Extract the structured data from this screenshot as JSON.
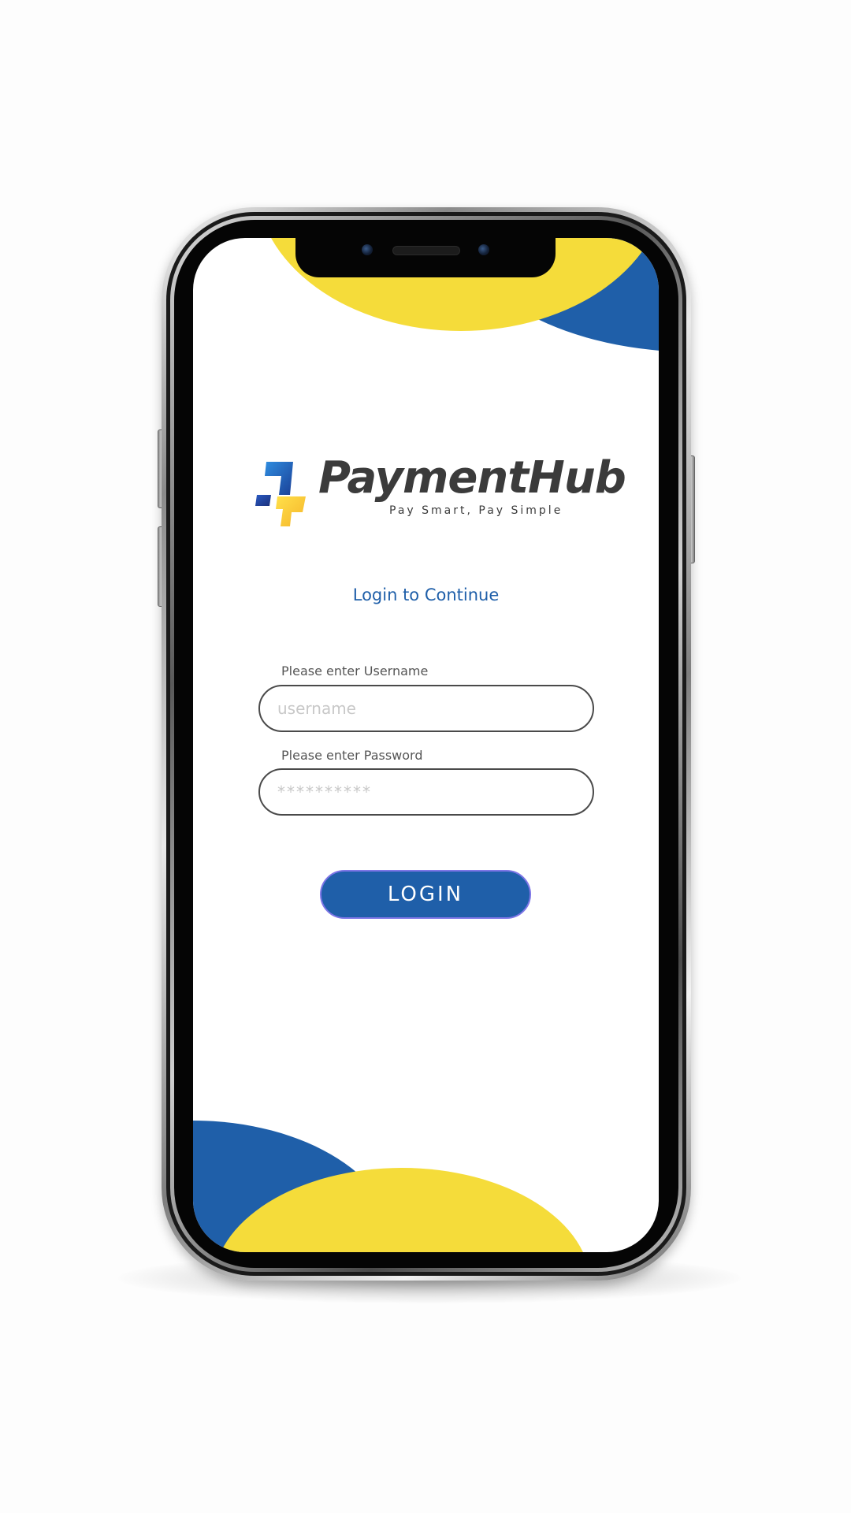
{
  "app": {
    "brand_name": "PaymentHub",
    "tagline": "Pay Smart, Pay Simple"
  },
  "login": {
    "heading": "Login to Continue",
    "username_label": "Please enter Username",
    "username_placeholder": "username",
    "password_label": "Please enter Password",
    "password_placeholder": "**********",
    "submit_label": "LOGIN"
  },
  "colors": {
    "primary_blue": "#1f5fa9",
    "accent_yellow": "#f5dc3a",
    "logo_text": "#3b3b3b",
    "button_border": "#7d75e6"
  },
  "icons": {
    "logo_mark": "paymenthub-logo-mark-icon",
    "front_camera": "camera-icon",
    "earpiece": "speaker-icon"
  }
}
